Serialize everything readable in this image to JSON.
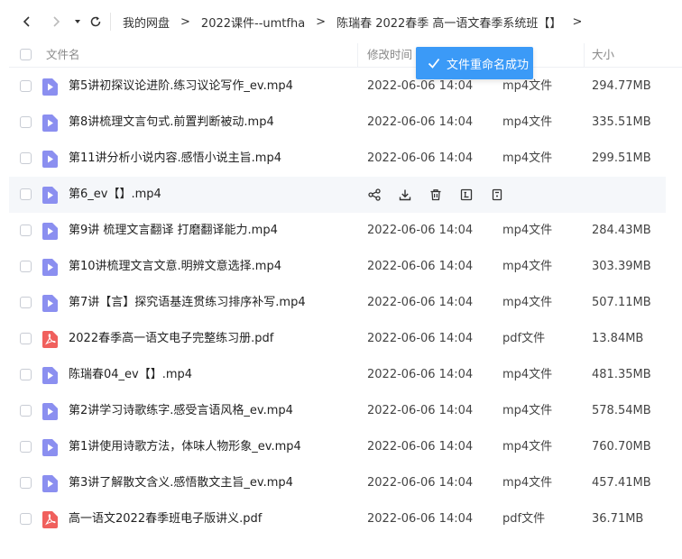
{
  "breadcrumb": [
    "我的网盘",
    "2022课件--umtfha",
    "陈瑞春 2022春季 高一语文春季系统班【】"
  ],
  "breadcrumb_separator": ">",
  "header": {
    "name": "文件名",
    "time": "修改时间",
    "size": "大小"
  },
  "toast": {
    "message": "文件重命名成功"
  },
  "files": [
    {
      "name": "第5讲初探议论进阶.练习议论写作_ev.mp4",
      "time": "2022-06-06 14:04",
      "type": "mp4文件",
      "size": "294.77MB",
      "kind": "video"
    },
    {
      "name": "第8讲梳理文言句式.前置判断被动.mp4",
      "time": "2022-06-06 14:04",
      "type": "mp4文件",
      "size": "335.51MB",
      "kind": "video"
    },
    {
      "name": "第11讲分析小说内容.感悟小说主旨.mp4",
      "time": "2022-06-06 14:04",
      "type": "mp4文件",
      "size": "299.51MB",
      "kind": "video"
    },
    {
      "name": "第6_ev【】.mp4",
      "time": "",
      "type": "",
      "size": "",
      "kind": "video"
    },
    {
      "name": "第9讲 梳理文言翻译 打磨翻译能力.mp4",
      "time": "2022-06-06 14:04",
      "type": "mp4文件",
      "size": "284.43MB",
      "kind": "video"
    },
    {
      "name": "第10讲梳理文言文意.明辨文意选择.mp4",
      "time": "2022-06-06 14:04",
      "type": "mp4文件",
      "size": "303.39MB",
      "kind": "video"
    },
    {
      "name": "第7讲【言】探究语基连贯练习排序补写.mp4",
      "time": "2022-06-06 14:04",
      "type": "mp4文件",
      "size": "507.11MB",
      "kind": "video"
    },
    {
      "name": "2022春季高一语文电子完整练习册.pdf",
      "time": "2022-06-06 14:04",
      "type": "pdf文件",
      "size": "13.84MB",
      "kind": "pdf"
    },
    {
      "name": "陈瑞春04_ev【】.mp4",
      "time": "2022-06-06 14:04",
      "type": "mp4文件",
      "size": "481.35MB",
      "kind": "video"
    },
    {
      "name": "第2讲学习诗歌练字.感受言语风格_ev.mp4",
      "time": "2022-06-06 14:04",
      "type": "mp4文件",
      "size": "578.54MB",
      "kind": "video"
    },
    {
      "name": "第1讲使用诗歌方法，体味人物形象_ev.mp4",
      "time": "2022-06-06 14:04",
      "type": "mp4文件",
      "size": "760.70MB",
      "kind": "video"
    },
    {
      "name": "第3讲了解散文含义.感悟散文主旨_ev.mp4",
      "time": "2022-06-06 14:04",
      "type": "mp4文件",
      "size": "457.41MB",
      "kind": "video"
    },
    {
      "name": "高一语文2022春季班电子版讲义.pdf",
      "time": "2022-06-06 14:04",
      "type": "pdf文件",
      "size": "36.71MB",
      "kind": "pdf"
    }
  ],
  "hover_row_index": 3,
  "hover_actions": [
    "share-icon",
    "download-icon",
    "delete-icon",
    "rename-icon",
    "more-icon"
  ],
  "colors": {
    "video_icon": "#8b8ff0",
    "pdf_icon": "#f0605d",
    "toast_bg": "#3b9af7"
  }
}
